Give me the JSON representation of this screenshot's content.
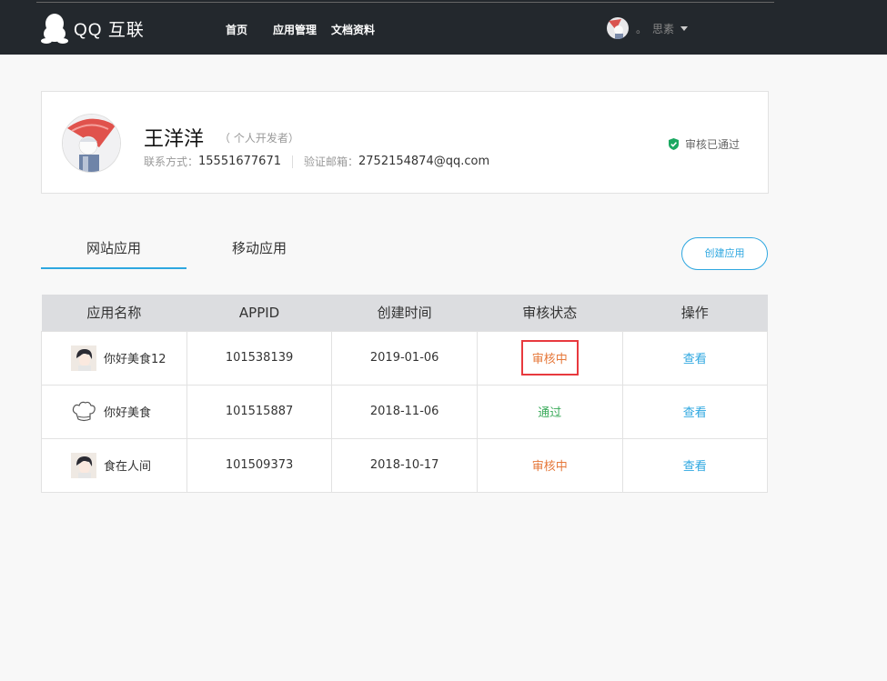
{
  "header": {
    "brand": "QQ 互联",
    "nav": [
      {
        "label": "首页"
      },
      {
        "label": "应用管理"
      },
      {
        "label": "文档资料"
      }
    ],
    "user": {
      "dot": "。",
      "name": "思素"
    }
  },
  "profile": {
    "name": "王洋洋",
    "type": "（ 个人开发者）",
    "contact_label": "联系方式：",
    "contact_value": "15551677671",
    "email_label": "验证邮箱：",
    "email_value": "2752154874@qq.com",
    "status": "审核已通过",
    "status_color": "#1aa861"
  },
  "tabs": [
    {
      "label": "网站应用",
      "active": true
    },
    {
      "label": "移动应用",
      "active": false
    }
  ],
  "create_button": "创建应用",
  "table": {
    "headers": [
      "应用名称",
      "APPID",
      "创建时间",
      "审核状态",
      "操作"
    ],
    "rows": [
      {
        "icon": "anime-avatar-icon",
        "name": "你好美食12",
        "appid": "101538139",
        "date": "2019-01-06",
        "status": "审核中",
        "action": "查看"
      },
      {
        "icon": "chef-hat-icon",
        "name": "你好美食",
        "appid": "101515887",
        "date": "2018-11-06",
        "status": "通过",
        "action": "查看"
      },
      {
        "icon": "anime-avatar-icon",
        "name": "食在人间",
        "appid": "101509373",
        "date": "2018-10-17",
        "status": "审核中",
        "action": "查看"
      }
    ]
  },
  "colors": {
    "accent": "#2ea7e0",
    "pending": "#e6783a",
    "passed": "#3aaa5a",
    "highlight": "#e8393e"
  }
}
